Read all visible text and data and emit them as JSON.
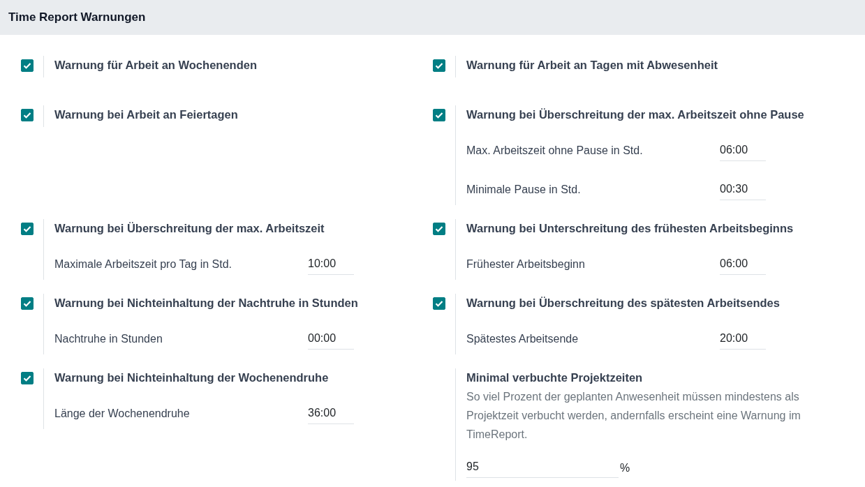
{
  "header": {
    "title": "Time Report Warnungen"
  },
  "settings": [
    {
      "kind": "checkbox",
      "title": "Warnung für Arbeit an Wochenenden",
      "checked": true
    },
    {
      "kind": "checkbox",
      "title": "Warnung für Arbeit an Tagen mit Abwesenheit",
      "checked": true
    },
    {
      "kind": "checkbox",
      "title": "Warnung bei Arbeit an Feiertagen",
      "checked": true
    },
    {
      "kind": "checkbox",
      "title": "Warnung bei Überschreitung der max. Arbeitszeit ohne Pause",
      "checked": true,
      "fields": [
        {
          "label": "Max. Arbeitszeit ohne Pause in Std.",
          "value": "06:00"
        },
        {
          "label": "Minimale Pause in Std.",
          "value": "00:30"
        }
      ]
    },
    {
      "kind": "checkbox",
      "title": "Warnung bei Überschreitung der max. Arbeitszeit",
      "checked": true,
      "fields": [
        {
          "label": "Maximale Arbeitszeit pro Tag in Std.",
          "value": "10:00"
        }
      ]
    },
    {
      "kind": "checkbox",
      "title": "Warnung bei Unterschreitung des frühesten Arbeitsbeginns",
      "checked": true,
      "fields": [
        {
          "label": "Frühester Arbeitsbeginn",
          "value": "06:00"
        }
      ]
    },
    {
      "kind": "checkbox",
      "title": "Warnung bei Nichteinhaltung der Nachtruhe in Stunden",
      "checked": true,
      "fields": [
        {
          "label": "Nachtruhe in Stunden",
          "value": "00:00"
        }
      ]
    },
    {
      "kind": "checkbox",
      "title": "Warnung bei Überschreitung des spätesten Arbeitsendes",
      "checked": true,
      "fields": [
        {
          "label": "Spätestes Arbeitsende",
          "value": "20:00"
        }
      ]
    },
    {
      "kind": "checkbox",
      "title": "Warnung bei Nichteinhaltung der Wochenendruhe",
      "checked": true,
      "fields": [
        {
          "label": "Länge der Wochenendruhe",
          "value": "36:00"
        }
      ]
    },
    {
      "kind": "info",
      "title": "Minimal verbuchte Projektzeiten",
      "description": "So viel Prozent der geplanten Anwesenheit müssen mindestens als Projektzeit verbucht werden, andernfalls erscheint eine Warnung im TimeReport.",
      "value": "95",
      "unit": "%"
    }
  ]
}
